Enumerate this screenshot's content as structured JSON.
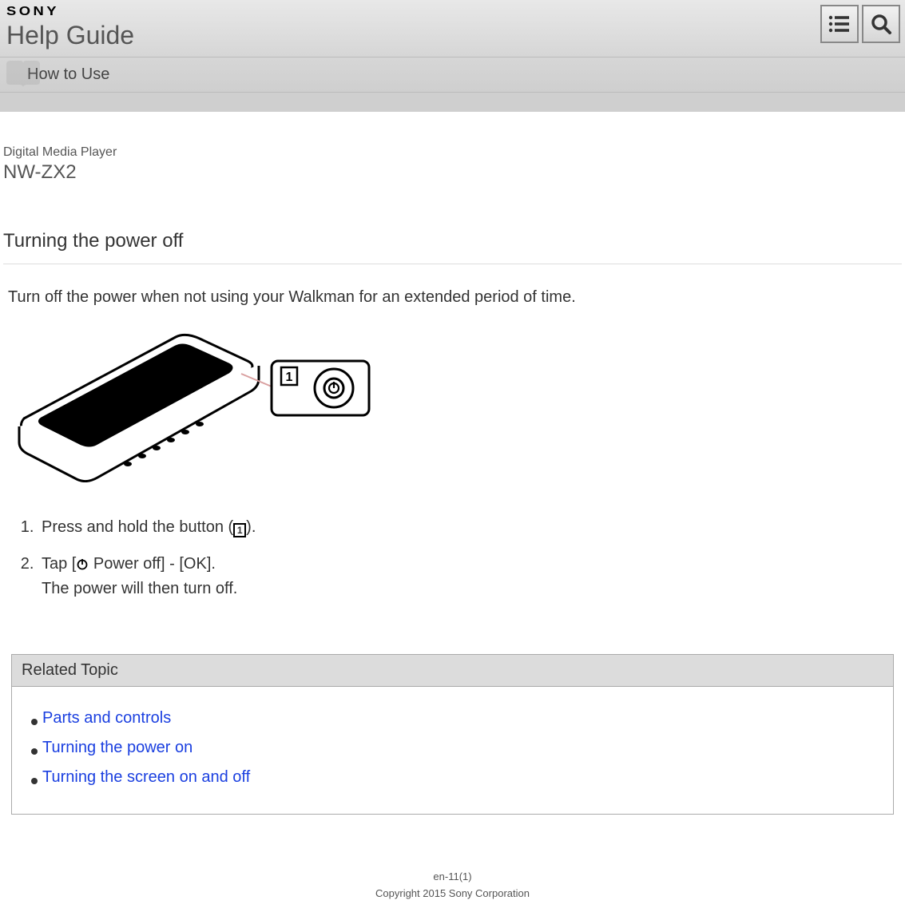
{
  "header": {
    "brand": "SONY",
    "title": "Help Guide"
  },
  "subheader": {
    "label": "How to Use"
  },
  "product": {
    "category": "Digital Media Player",
    "model": "NW-ZX2"
  },
  "page": {
    "title": "Turning the power off",
    "intro": "Turn off the power when not using your Walkman for an extended period of time."
  },
  "steps": [
    {
      "pre": "Press and hold the button (",
      "boxed": "1",
      "post": ")."
    },
    {
      "pre": "Tap [",
      "mid": " Power off] - [OK].",
      "sub": "The power will then turn off."
    }
  ],
  "related": {
    "header": "Related Topic",
    "items": [
      "Parts and controls",
      "Turning the power on",
      "Turning the screen on and off"
    ]
  },
  "footer": {
    "doc_id": "en-11(1)",
    "copyright": "Copyright 2015 Sony Corporation"
  },
  "callout": {
    "label": "1"
  }
}
